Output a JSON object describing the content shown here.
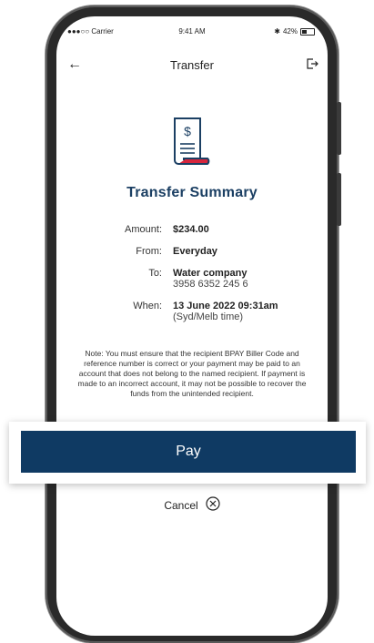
{
  "status_bar": {
    "carrier": "●●●○○ Carrier",
    "time": "9:41 AM",
    "battery": "42%"
  },
  "nav": {
    "title": "Transfer",
    "back_icon": "arrow-left-icon",
    "logout_icon": "logout-icon"
  },
  "summary": {
    "title": "Transfer Summary",
    "rows": [
      {
        "label": "Amount:",
        "value": "$234.00"
      },
      {
        "label": "From:",
        "value": "Everyday"
      },
      {
        "label": "To:",
        "value": "Water company",
        "subvalue": "3958 6352 245 6"
      },
      {
        "label": "When:",
        "value": "13 June 2022 09:31am",
        "subvalue": "(Syd/Melb time)"
      }
    ]
  },
  "note": "Note: You must ensure that the recipient BPAY Biller Code and reference number is correct or your payment may be paid to an account that does not belong to the named recipient. If payment is made to an incorrect account, it may not be possible to recover the funds from the unintended recipient.",
  "actions": {
    "pay_label": "Pay",
    "cancel_label": "Cancel"
  },
  "colors": {
    "primary": "#0f3a63",
    "accent": "#d7263d",
    "title": "#1b3f63"
  }
}
